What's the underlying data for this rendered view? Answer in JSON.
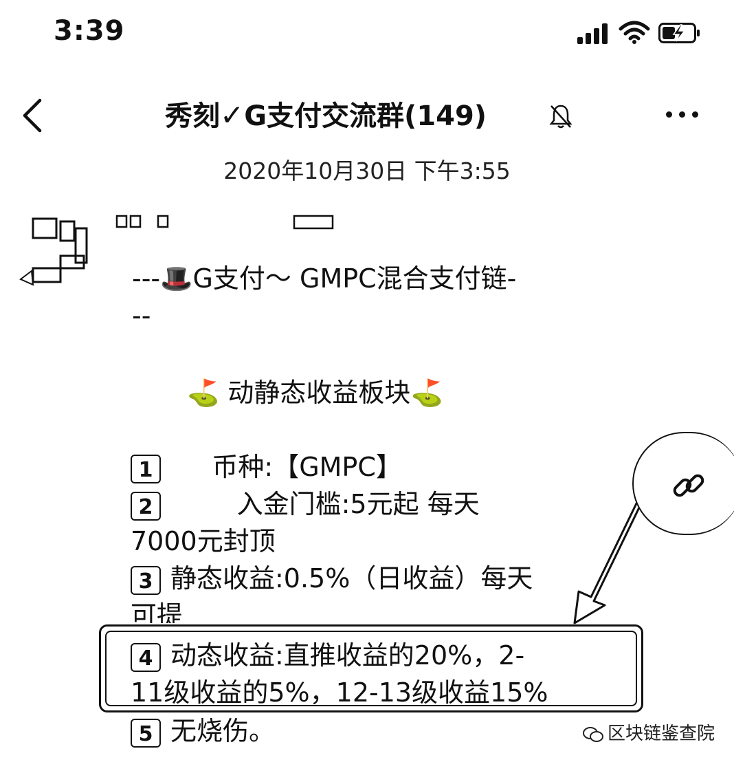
{
  "status_bar": {
    "time": "3:39"
  },
  "header": {
    "title": "秀刻",
    "check_glyph": "✓",
    "title_rest": "G支付交流群(149)",
    "muted_icon": "bell-slash-icon"
  },
  "chat": {
    "datetime": "2020年10月30日 下午3:55",
    "message": {
      "line1": "---",
      "emoji": "🎩",
      "line1_rest": "G支付～ GMPC混合支付链-",
      "line2": "--",
      "section_flag_left": "⛳",
      "section_title": "动静态收益板块",
      "section_flag_right": "⛳",
      "items": [
        {
          "num": "1",
          "text": "     币种:【GMPC】"
        },
        {
          "num": "2",
          "text": "        入金门槛:5元起 每天"
        },
        {
          "cont": "7000元封顶"
        },
        {
          "num": "3",
          "text": "静态收益:0.5%（日收益）每天"
        },
        {
          "cont": "可提"
        },
        {
          "num": "4",
          "text": "动态收益:直推收益的20%，2-"
        },
        {
          "cont": "11级收益的5%，12-13级收益15%"
        },
        {
          "num": "5",
          "text": "无烧伤。"
        }
      ]
    }
  },
  "watermark": {
    "text": "区块链鉴查院"
  },
  "colors": {
    "ink": "#111111",
    "background": "#ffffff"
  }
}
